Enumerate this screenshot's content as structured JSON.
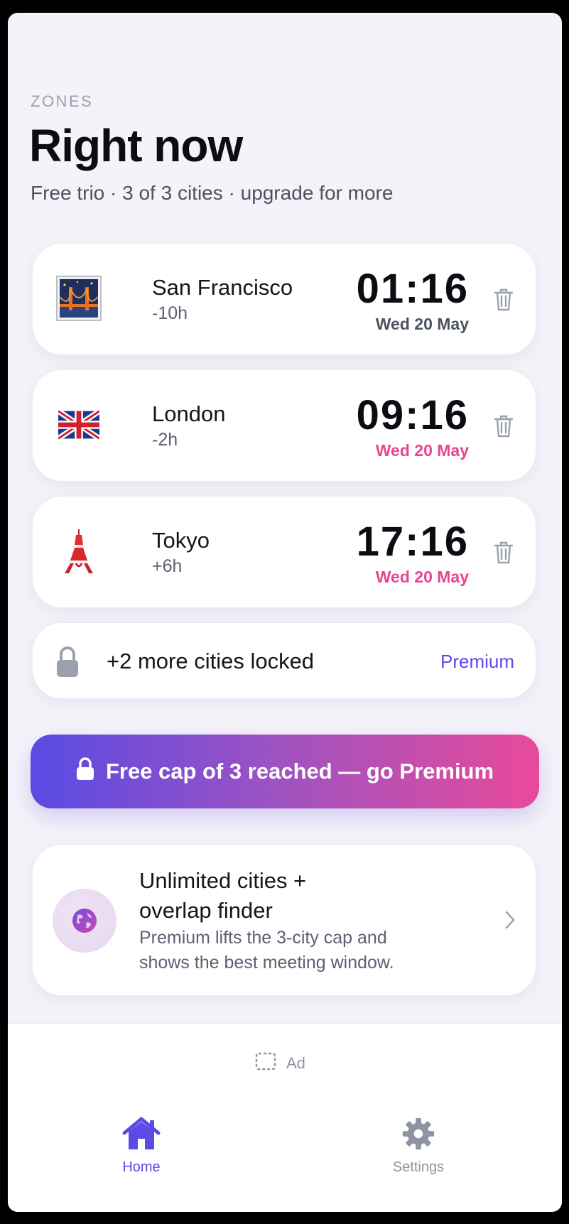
{
  "header": {
    "eyebrow": "ZONES",
    "title": "Right now",
    "subtitle": "Free trio · 3 of 3 cities · upgrade for more"
  },
  "cities": [
    {
      "name": "San Francisco",
      "offset": "-10h",
      "time": "01:16",
      "date": "Wed 20 May",
      "icon": "golden-gate-bridge-icon"
    },
    {
      "name": "London",
      "offset": "-2h",
      "time": "09:16",
      "date": "Wed 20 May",
      "icon": "uk-flag-icon"
    },
    {
      "name": "Tokyo",
      "offset": "+6h",
      "time": "17:16",
      "date": "Wed 20 May",
      "icon": "tokyo-tower-icon"
    }
  ],
  "locked": {
    "text": "+2 more cities locked",
    "link": "Premium"
  },
  "cta": {
    "label": "Free cap of 3 reached — go Premium"
  },
  "promo": {
    "title_line1": "Unlimited cities +",
    "title_line2": "overlap finder",
    "desc_line1": "Premium lifts the 3-city cap and",
    "desc_line2": "shows the best meeting window."
  },
  "ad": {
    "label": "Ad"
  },
  "tabs": [
    {
      "label": "Home",
      "active": true
    },
    {
      "label": "Settings",
      "active": false
    }
  ],
  "colors": {
    "accent": "#5b4ae6",
    "pink": "#e94591",
    "gradient_start": "#5a4ae4",
    "gradient_end": "#e94a9a"
  }
}
